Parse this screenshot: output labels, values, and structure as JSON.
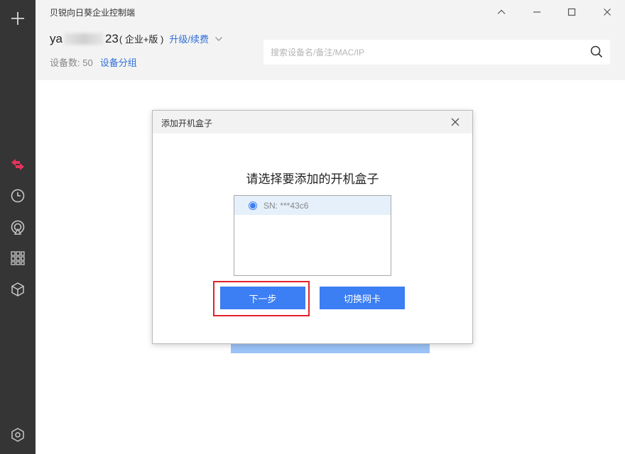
{
  "window": {
    "title": "贝锐向日葵企业控制端"
  },
  "account": {
    "name_prefix": "ya",
    "name_suffix": "23",
    "edition": "( 企业+版 )",
    "upgrade_label": "升级/续费"
  },
  "devices": {
    "count_label": "设备数:",
    "count": "50",
    "group_label": "设备分组"
  },
  "search": {
    "placeholder": "搜索设备名/备注/MAC/IP"
  },
  "sidebar": {
    "icons": [
      "plus-icon",
      "remote-transfer-icon",
      "history-clock-icon",
      "wireless-broadcast-icon",
      "apps-grid-icon",
      "box-cube-icon",
      "settings-hexagon-icon"
    ],
    "active_color": "#e5335a"
  },
  "dialog": {
    "title": "添加开机盒子",
    "heading": "请选择要添加的开机盒子",
    "boxes": [
      {
        "label": "SN: ***43c6",
        "selected": true
      }
    ],
    "next_label": "下一步",
    "switch_label": "切换网卡"
  },
  "colors": {
    "accent": "#3c7ef3",
    "link": "#2f6fd8",
    "highlight": "#e0232a",
    "rail": "#353535"
  }
}
